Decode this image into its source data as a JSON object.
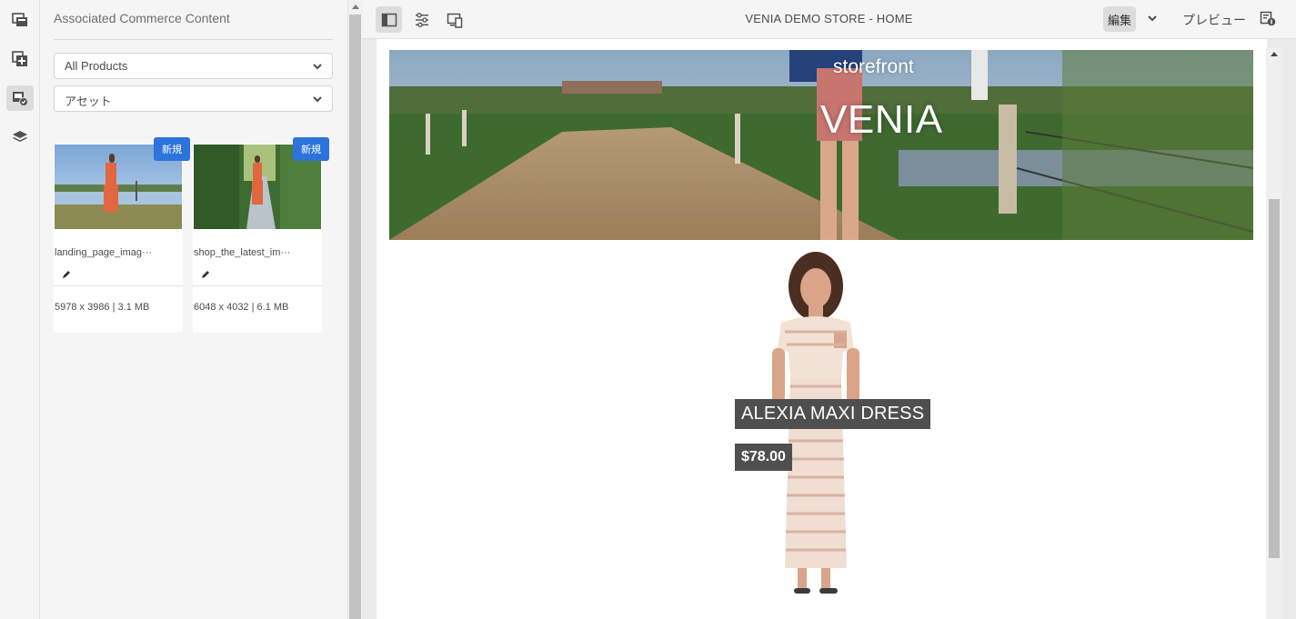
{
  "rail": {
    "items": [
      {
        "name": "page-tree-icon"
      },
      {
        "name": "add-component-icon"
      },
      {
        "name": "commerce-assets-icon",
        "active": true
      },
      {
        "name": "layers-icon"
      }
    ]
  },
  "panel": {
    "title": "Associated Commerce Content",
    "filter_select": "All Products",
    "type_select": "アセット",
    "cards": [
      {
        "badge": "新規",
        "name": "landing_page_imag···",
        "meta": "5978 x 3986 | 3.1 MB"
      },
      {
        "badge": "新規",
        "name": "shop_the_latest_im···",
        "meta": "6048 x 4032 | 6.1 MB"
      }
    ]
  },
  "toolbar": {
    "page_title": "VENIA DEMO STORE - HOME",
    "mode_label": "編集",
    "preview_label": "プレビュー",
    "icons": [
      "side-panel-toggle-icon",
      "page-properties-icon",
      "emulator-icon",
      "page-info-icon"
    ]
  },
  "page": {
    "hero_subtitle": "storefront",
    "hero_title": "VENIA",
    "product_name": "ALEXIA MAXI DRESS",
    "product_price": "$78.00"
  },
  "colors": {
    "accent_blue": "#2d73dc",
    "label_bg": "#4f4f4f"
  }
}
